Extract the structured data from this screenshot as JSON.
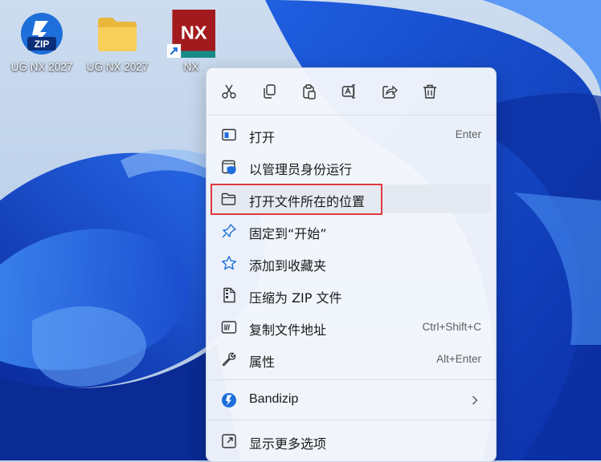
{
  "desktop": {
    "icons": [
      {
        "label": "UG NX 2027",
        "icon": "zip-archive-icon"
      },
      {
        "label": "UG NX 2027",
        "icon": "folder-icon"
      },
      {
        "label": "NX",
        "icon": "nx-shortcut-icon",
        "logo_text": "NX"
      }
    ]
  },
  "context_menu": {
    "toolbar": [
      {
        "name": "cut",
        "icon": "scissors-icon"
      },
      {
        "name": "copy",
        "icon": "copy-icon"
      },
      {
        "name": "paste",
        "icon": "paste-icon"
      },
      {
        "name": "rename",
        "icon": "rename-icon"
      },
      {
        "name": "share",
        "icon": "share-icon"
      },
      {
        "name": "delete",
        "icon": "trash-icon"
      }
    ],
    "items": [
      {
        "label": "打开",
        "shortcut": "Enter",
        "icon": "open-window-icon"
      },
      {
        "label": "以管理员身份运行",
        "shortcut": "",
        "icon": "admin-shield-icon"
      },
      {
        "label": "打开文件所在的位置",
        "shortcut": "",
        "icon": "folder-open-icon",
        "highlighted": true
      },
      {
        "label": "固定到“开始”",
        "shortcut": "",
        "icon": "pin-icon"
      },
      {
        "label": "添加到收藏夹",
        "shortcut": "",
        "icon": "star-icon"
      },
      {
        "label": "压缩为 ZIP 文件",
        "shortcut": "",
        "icon": "zip-file-icon"
      },
      {
        "label": "复制文件地址",
        "shortcut": "Ctrl+Shift+C",
        "icon": "copy-path-icon"
      },
      {
        "label": "属性",
        "shortcut": "Alt+Enter",
        "icon": "wrench-icon"
      },
      {
        "label": "Bandizip",
        "shortcut": "",
        "icon": "bandizip-icon",
        "submenu": true
      },
      {
        "label": "显示更多选项",
        "shortcut": "",
        "icon": "more-options-icon"
      }
    ]
  },
  "colors": {
    "accent_blue": "#1e6fd9",
    "highlight_border": "#e0393e",
    "nx_red": "#a31a1e"
  }
}
